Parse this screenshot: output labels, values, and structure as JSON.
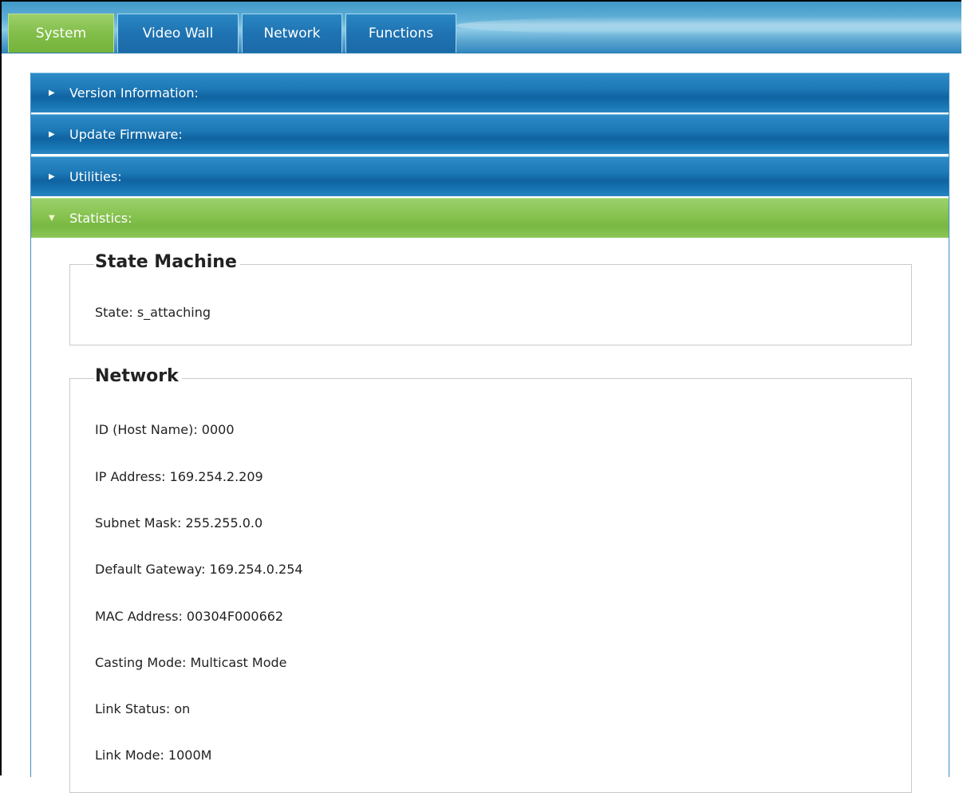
{
  "tabs": [
    {
      "label": "System",
      "active": true
    },
    {
      "label": "Video Wall",
      "active": false
    },
    {
      "label": "Network",
      "active": false
    },
    {
      "label": "Functions",
      "active": false
    }
  ],
  "accordion": [
    {
      "label": "Version Information:",
      "expanded": false
    },
    {
      "label": "Update Firmware:",
      "expanded": false
    },
    {
      "label": "Utilities:",
      "expanded": false
    },
    {
      "label": "Statistics:",
      "expanded": true
    }
  ],
  "statistics": {
    "state_machine": {
      "title": "State Machine",
      "state": "State: s_attaching"
    },
    "network": {
      "title": "Network",
      "rows": [
        "ID (Host Name): 0000",
        "IP Address: 169.254.2.209",
        "Subnet Mask: 255.255.0.0",
        "Default Gateway: 169.254.0.254",
        "MAC Address: 00304F000662",
        "Casting Mode: Multicast Mode",
        "Link Status: on",
        "Link Mode: 1000M"
      ]
    }
  },
  "colors": {
    "active_green": "#82be4a",
    "header_blue": "#1d78b6"
  },
  "icons": {
    "collapsed": "triangle-right-icon",
    "expanded": "triangle-down-icon"
  }
}
